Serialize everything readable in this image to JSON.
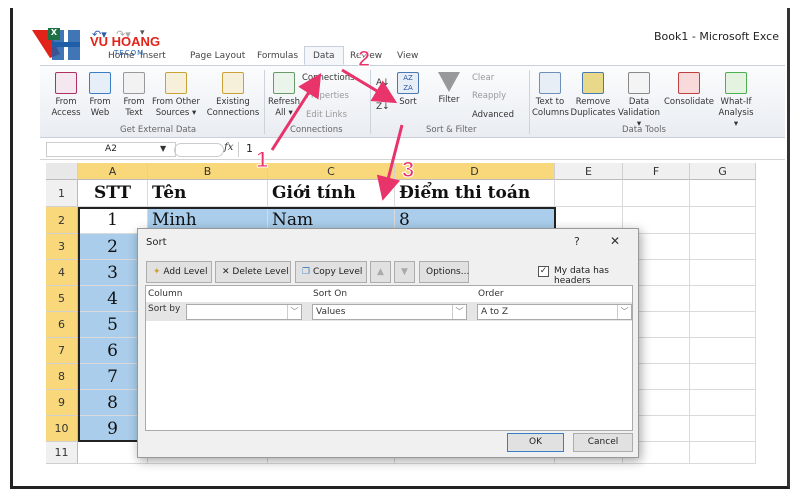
{
  "window": {
    "title": "Book1  -  Microsoft Exce"
  },
  "logo": {
    "text": "VU HOANG",
    "subtext": "TECOM"
  },
  "ribbon_tabs": [
    {
      "label": "Home"
    },
    {
      "label": "Insert"
    },
    {
      "label": "Page Layout"
    },
    {
      "label": "Formulas"
    },
    {
      "label": "Data",
      "active": true
    },
    {
      "label": "Review"
    },
    {
      "label": "View"
    }
  ],
  "ribbon": {
    "get_external": {
      "label": "Get External Data",
      "buttons": [
        {
          "l1": "From",
          "l2": "Access"
        },
        {
          "l1": "From",
          "l2": "Web"
        },
        {
          "l1": "From",
          "l2": "Text"
        },
        {
          "l1": "From Other",
          "l2": "Sources ▾"
        },
        {
          "l1": "Existing",
          "l2": "Connections"
        }
      ]
    },
    "connections": {
      "label": "Connections",
      "refresh": {
        "l1": "Refresh",
        "l2": "All ▾"
      },
      "items": [
        "Connections",
        "Properties",
        "Edit Links"
      ]
    },
    "sort_filter": {
      "label": "Sort & Filter",
      "sort": "Sort",
      "filter": "Filter",
      "items": [
        "Clear",
        "Reapply",
        "Advanced"
      ]
    },
    "data_tools": {
      "label": "Data Tools",
      "buttons": [
        {
          "l1": "Text to",
          "l2": "Columns"
        },
        {
          "l1": "Remove",
          "l2": "Duplicates"
        },
        {
          "l1": "Data",
          "l2": "Validation ▾"
        },
        {
          "l1": "Consolidate",
          "l2": ""
        },
        {
          "l1": "What-If",
          "l2": "Analysis ▾"
        }
      ]
    }
  },
  "formula_bar": {
    "name_box": "A2",
    "fx": "fx",
    "value": "1"
  },
  "sheet": {
    "columns": [
      "A",
      "B",
      "C",
      "D",
      "E",
      "F",
      "G"
    ],
    "rows": [
      "1",
      "2",
      "3",
      "4",
      "5",
      "6",
      "7",
      "8",
      "9",
      "10",
      "11"
    ],
    "header": [
      "STT",
      "Tên",
      "Giới tính",
      "Điểm thi toán"
    ],
    "row2": [
      "1",
      "Minh",
      "Nam",
      "8"
    ],
    "stt": [
      "2",
      "3",
      "4",
      "5",
      "6",
      "7",
      "8",
      "9"
    ]
  },
  "dialog": {
    "title": "Sort",
    "help": "?",
    "close": "✕",
    "add_level": "Add Level",
    "delete_level": "Delete Level",
    "copy_level": "Copy Level",
    "options": "Options...",
    "my_data_has_headers": "My data has headers",
    "headers_checked": true,
    "col_column": "Column",
    "col_sort_on": "Sort On",
    "col_order": "Order",
    "sort_by": "Sort by",
    "column_value": "",
    "sort_on_value": "Values",
    "order_value": "A to Z",
    "ok": "OK",
    "cancel": "Cancel"
  },
  "annotations": {
    "steps": [
      "1",
      "2",
      "3"
    ],
    "color": "#e8336b"
  }
}
